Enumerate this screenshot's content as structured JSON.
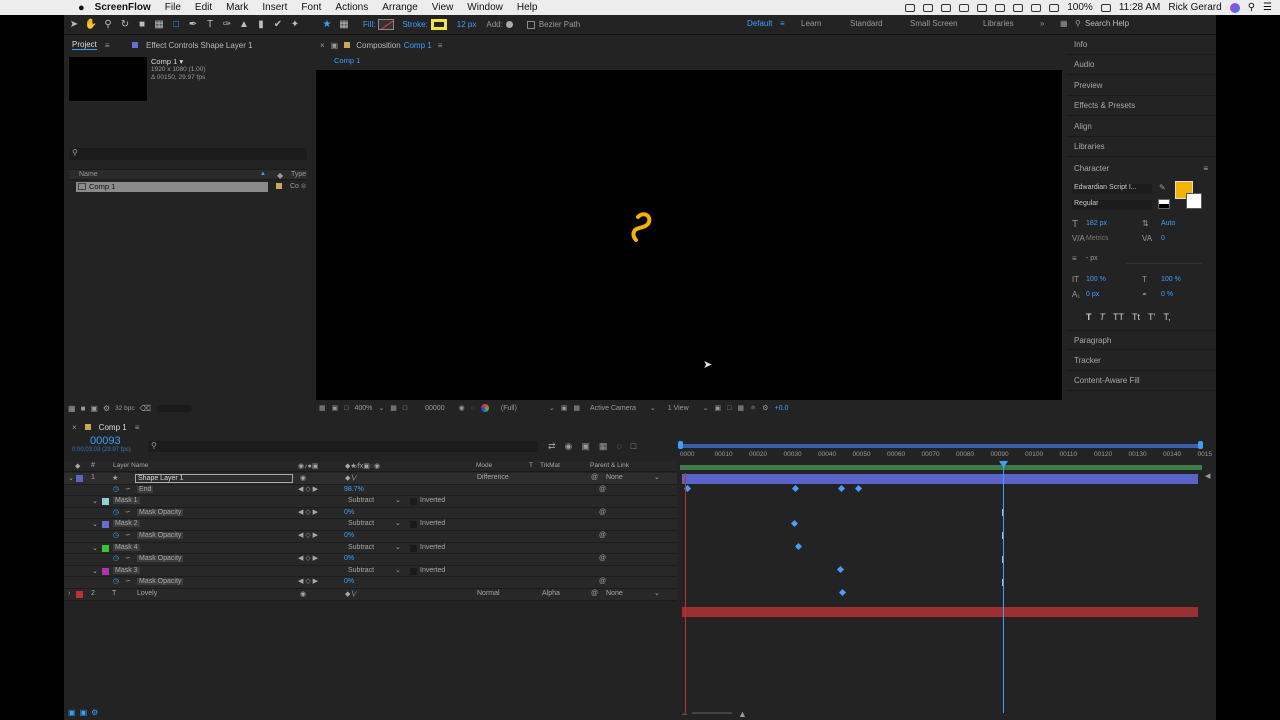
{
  "menubar": {
    "apple": "",
    "app_name": "ScreenFlow",
    "items": [
      "File",
      "Edit",
      "Mark",
      "Insert",
      "Font",
      "Actions",
      "Arrange",
      "View",
      "Window",
      "Help"
    ],
    "battery": "100%",
    "clock": "11:28 AM",
    "user": "Rick Gerard"
  },
  "toolbar": {
    "fill_label": "Fill:",
    "stroke_label": "Stroke:",
    "stroke_width": "12 px",
    "add_label": "Add:",
    "bezier_label": "Bezier Path",
    "workspaces": [
      "Default",
      "Learn",
      "Standard",
      "Small Screen",
      "Libraries"
    ],
    "search_placeholder": "Search Help"
  },
  "project": {
    "tab_project": "Project",
    "tab_effects": "Effect Controls Shape Layer 1",
    "comp_name": "Comp 1 ▾",
    "comp_size": "1920 x 1080 (1.00)",
    "comp_dur": "Δ 00150, 29.97 fps",
    "col_name": "Name",
    "col_type": "Type",
    "item_name": "Comp 1",
    "item_type": "Co",
    "bpc": "32 bpc"
  },
  "composition": {
    "tab_label": "Composition",
    "tab_comp": "Comp 1",
    "sub_tab": "Comp 1",
    "zoom": "400%",
    "timecode": "00000",
    "resolution": "(Full)",
    "camera": "Active Camera",
    "view": "1 View",
    "exposure": "+0.0"
  },
  "right_panels": {
    "items": [
      "Info",
      "Audio",
      "Preview",
      "Effects & Presets",
      "Align",
      "Libraries"
    ],
    "character_title": "Character",
    "font": "Edwardian Script I...",
    "style": "Regular",
    "size": "182 px",
    "leading": "Auto",
    "kerning": "Metrics",
    "tracking": "0",
    "stroke_w": "- px",
    "vscale": "100 %",
    "hscale": "100 %",
    "baseline": "0 px",
    "tsume": "0 %",
    "styles": [
      "T",
      "T",
      "TT",
      "Tt",
      "T’",
      "T,"
    ],
    "bottom_items": [
      "Paragraph",
      "Tracker",
      "Content-Aware Fill"
    ]
  },
  "timeline": {
    "tab": "Comp 1",
    "timecode": "00093",
    "timecode_sub": "0;00;03;03 (29.97 fps)",
    "col_layer_name": "Layer Name",
    "col_mode": "Mode",
    "col_t": "T",
    "col_trkmat": "TrkMat",
    "col_parent": "Parent & Link",
    "ruler": [
      "0000",
      "00010",
      "00020",
      "00030",
      "00040",
      "00050",
      "00060",
      "00070",
      "00080",
      "00090",
      "00100",
      "00110",
      "00120",
      "00130",
      "00140",
      "0015"
    ],
    "rows": [
      {
        "num": "1",
        "name": "Shape Layer 1",
        "mode": "Difference",
        "parent": "None"
      },
      {
        "name": "End",
        "value": "98.7%"
      },
      {
        "name": "Mask 1",
        "mode": "Subtract",
        "flag": "Inverted"
      },
      {
        "name": "Mask Opacity",
        "value": "0%"
      },
      {
        "name": "Mask 2",
        "mode": "Subtract",
        "flag": "Inverted"
      },
      {
        "name": "Mask Opacity",
        "value": "0%"
      },
      {
        "name": "Mask 4",
        "mode": "Subtract",
        "flag": "Inverted"
      },
      {
        "name": "Mask Opacity",
        "value": "0%"
      },
      {
        "name": "Mask 3",
        "mode": "Subtract",
        "flag": "Inverted"
      },
      {
        "name": "Mask Opacity",
        "value": "0%"
      },
      {
        "num": "2",
        "name": "Lovely",
        "mode": "Normal",
        "trkmat": "Alpha",
        "parent": "None"
      }
    ]
  },
  "colors": {
    "accent": "#3aa0ff",
    "panel": "#232323",
    "layer1_bar": "#5a63c8",
    "layer2_bar": "#9c2f2f",
    "shape_yellow": "#f2b200"
  }
}
